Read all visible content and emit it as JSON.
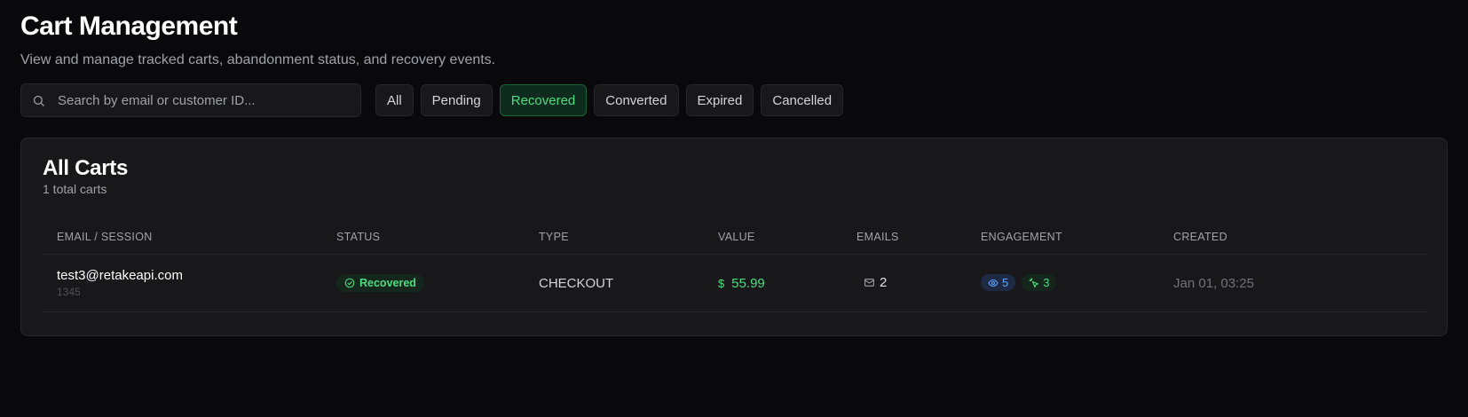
{
  "header": {
    "title": "Cart Management",
    "subtitle": "View and manage tracked carts, abandonment status, and recovery events."
  },
  "search": {
    "placeholder": "Search by email or customer ID...",
    "value": ""
  },
  "filters": [
    {
      "label": "All",
      "active": false
    },
    {
      "label": "Pending",
      "active": false
    },
    {
      "label": "Recovered",
      "active": true
    },
    {
      "label": "Converted",
      "active": false
    },
    {
      "label": "Expired",
      "active": false
    },
    {
      "label": "Cancelled",
      "active": false
    }
  ],
  "card": {
    "title": "All Carts",
    "subtitle": "1 total carts"
  },
  "table": {
    "columns": [
      "EMAIL / SESSION",
      "STATUS",
      "TYPE",
      "VALUE",
      "EMAILS",
      "ENGAGEMENT",
      "CREATED"
    ],
    "rows": [
      {
        "email": "test3@retakeapi.com",
        "session": "1345",
        "status": "Recovered",
        "type": "CHECKOUT",
        "value_symbol": "$",
        "value": "55.99",
        "emails": "2",
        "views": "5",
        "clicks": "3",
        "created": "Jan 01, 03:25"
      }
    ]
  },
  "colors": {
    "background": "#09090b",
    "card": "#18181b",
    "accent_green": "#4ade80",
    "accent_blue": "#60a5fa"
  },
  "icons": {
    "search": "search-icon",
    "status": "check-circle-icon",
    "value": "dollar-icon",
    "emails": "mail-icon",
    "views": "eye-icon",
    "clicks": "pointer-click-icon"
  }
}
